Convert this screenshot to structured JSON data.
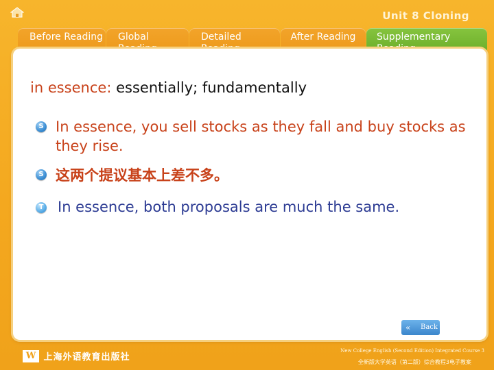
{
  "header": {
    "unit_title": "Unit 8 Cloning",
    "home_icon": "home-icon"
  },
  "tabs": [
    {
      "label": "Before Reading",
      "active": false
    },
    {
      "label": "Global Reading",
      "active": false
    },
    {
      "label": "Detailed Reading",
      "active": false
    },
    {
      "label": "After Reading",
      "active": false
    },
    {
      "label": "Supplementary Reading",
      "active": true
    }
  ],
  "content": {
    "term": "in essence:",
    "definition": "essentially; fundamentally",
    "examples": [
      {
        "badge": "S",
        "text": "In essence, you sell stocks as they fall and buy stocks as they rise."
      },
      {
        "badge": "S",
        "text": "这两个提议基本上差不多。"
      },
      {
        "badge": "T",
        "text": "In essence, both proposals are much the same."
      }
    ]
  },
  "back_button": {
    "label": "Back",
    "icon": "double-left-arrow-icon"
  },
  "footer": {
    "publisher_logo": "W",
    "publisher_name": "上海外语教育出版社",
    "book_en": "New College English (Second Edition) Integrated Course 3",
    "book_cn": "全新版大学英语（第二版）综合教程3电子教案"
  },
  "colors": {
    "background": "#f4a81f",
    "tab": "#ee9a1c",
    "tab_active": "#78b834",
    "term": "#c8421a",
    "translation": "#2c3b93",
    "button": "#3b86cc"
  }
}
